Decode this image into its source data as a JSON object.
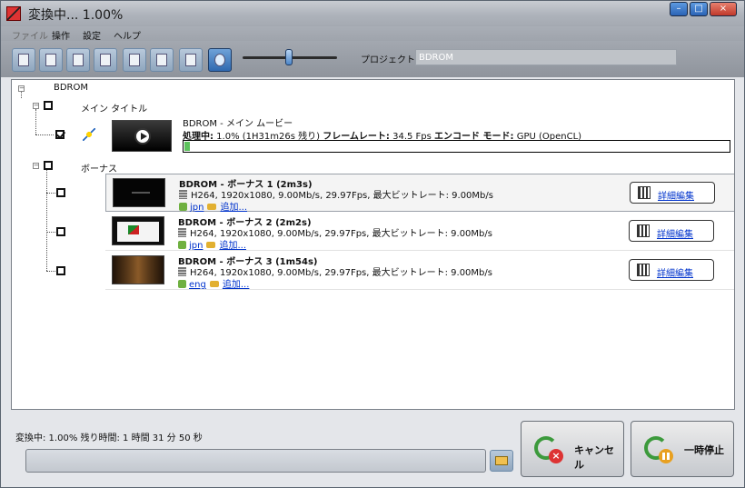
{
  "window": {
    "title": "変換中... 1.00%",
    "controls": [
      "–",
      "□",
      "×"
    ]
  },
  "menu": [
    "ファイル",
    "操作",
    "設定",
    "ヘルプ"
  ],
  "toolbar": {
    "icons": [
      "load-disc-icon",
      "load-iso-icon",
      "load-folder-icon",
      "add-video-icon",
      "remove-icon",
      "output-profile-icon",
      "merge-icon",
      "preview-icon"
    ]
  },
  "project": {
    "label": "プロジェクト名",
    "value": "BDROM"
  },
  "tree": {
    "root": "BDROM",
    "main_group": "メイン タイトル",
    "main": {
      "title": "BDROM - メイン ムービー",
      "status_label": "処理中:",
      "status_value": " 1.0% (1H31m26s 残り) ",
      "fps_label": "フレームレート:",
      "fps_value": " 34.5 Fps ",
      "mode_label": "エンコード モード:",
      "mode_value": " GPU (OpenCL)",
      "progress": 0.01
    },
    "bonus_group": "ボーナス",
    "bonus": [
      {
        "title": "BDROM - ボーナス 1 (2m3s)",
        "spec": "H264, 1920x1080, 9.00Mb/s, 29.97Fps, 最大ビットレート: 9.00Mb/s",
        "lang": "jpn",
        "add": "追加...",
        "edit": "詳細編集"
      },
      {
        "title": "BDROM - ボーナス 2 (2m2s)",
        "spec": "H264, 1920x1080, 9.00Mb/s, 29.97Fps, 最大ビットレート: 9.00Mb/s",
        "lang": "jpn",
        "add": "追加...",
        "edit": "詳細編集"
      },
      {
        "title": "BDROM - ボーナス 3 (1m54s)",
        "spec": "H264, 1920x1080, 9.00Mb/s, 29.97Fps, 最大ビットレート: 9.00Mb/s",
        "lang": "eng",
        "add": "追加...",
        "edit": "詳細編集"
      }
    ]
  },
  "footer": {
    "status": "変換中: 1.00% 残り時間: 1 時間 31 分 50 秒",
    "cancel": "キャンセル",
    "pause": "一時停止"
  }
}
